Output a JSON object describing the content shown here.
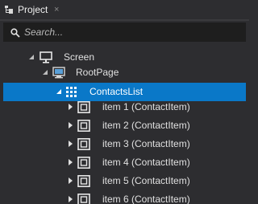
{
  "tab": {
    "label": "Project",
    "close_glyph": "×"
  },
  "search": {
    "placeholder": "Search...",
    "value": ""
  },
  "tree": {
    "screen": {
      "label": "Screen",
      "icon": "monitor-icon",
      "expanded": true
    },
    "root_page": {
      "label": "RootPage",
      "icon": "page-icon",
      "expanded": true
    },
    "contacts_list": {
      "label": "ContactsList",
      "icon": "grid-list-icon",
      "expanded": true,
      "selected": true
    },
    "items": [
      {
        "label": "item 1 (ContactItem)",
        "icon": "square-node-icon",
        "expanded": false
      },
      {
        "label": "item 2 (ContactItem)",
        "icon": "square-node-icon",
        "expanded": false
      },
      {
        "label": "item 3 (ContactItem)",
        "icon": "square-node-icon",
        "expanded": false
      },
      {
        "label": "item 4 (ContactItem)",
        "icon": "square-node-icon",
        "expanded": false
      },
      {
        "label": "item 5 (ContactItem)",
        "icon": "square-node-icon",
        "expanded": false
      },
      {
        "label": "item 6 (ContactItem)",
        "icon": "square-node-icon",
        "expanded": false
      }
    ]
  },
  "colors": {
    "background": "#2d2d30",
    "search_background": "#1e1e1e",
    "selection": "#0a78c8",
    "text": "#e0e0e0"
  }
}
